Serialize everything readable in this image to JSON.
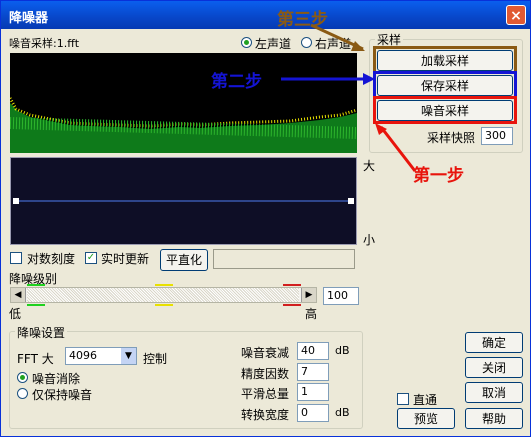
{
  "window": {
    "title": "降噪器",
    "close_glyph": "×"
  },
  "noise_sample_label": "噪音采样:1.fft",
  "channels": {
    "left": "左声道",
    "right": "右声道"
  },
  "scale": {
    "big": "大",
    "small": "小"
  },
  "options": {
    "log_scale": "对数刻度",
    "realtime_update": "实时更新",
    "flatten_button": "平直化"
  },
  "level": {
    "label": "降噪级别",
    "low": "低",
    "high": "高",
    "value": "100"
  },
  "sampling": {
    "group_title": "采样",
    "load_button": "加载采样",
    "save_button": "保存采样",
    "noise_button": "噪音采样",
    "snapshot_label": "采样快照",
    "snapshot_value": "300"
  },
  "annotations": {
    "step1": "第一步",
    "step2": "第二步",
    "step3": "第三步"
  },
  "settings": {
    "group_title": "降噪设置",
    "fft_label": "FFT 大",
    "fft_value": "4096",
    "control_label": "控制",
    "remove_noise": "噪音消除",
    "keep_noise": "仅保持噪音"
  },
  "params": {
    "attenuation_label": "噪音衰减",
    "attenuation_value": "40",
    "attenuation_unit": "dB",
    "precision_label": "精度因数",
    "precision_value": "7",
    "smoothing_label": "平滑总量",
    "smoothing_value": "1",
    "transition_label": "转换宽度",
    "transition_value": "0",
    "transition_unit": "dB"
  },
  "bottom": {
    "bypass": "直通",
    "preview": "预览",
    "ok": "确定",
    "close": "关闭",
    "cancel": "取消",
    "help": "帮助"
  },
  "colors": {
    "step1": "#E8140C",
    "step2": "#1414D4",
    "step3": "#8A5A14"
  }
}
